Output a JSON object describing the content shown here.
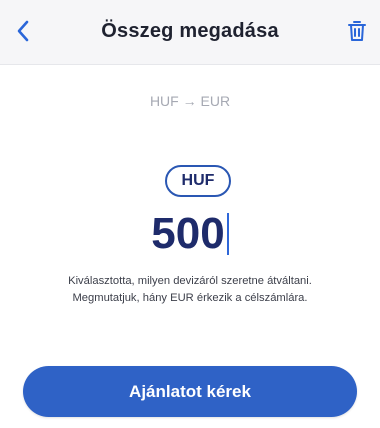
{
  "header": {
    "title": "Összeg megadása",
    "back_icon": "chevron-left-icon",
    "trash_icon": "trash-icon"
  },
  "conversion": {
    "pair_label": "HUF → EUR"
  },
  "amount": {
    "currency": "HUF",
    "value": "500"
  },
  "helper": {
    "line1": "Kiválasztotta, milyen devizáról szeretne átváltani.",
    "line2": "Megmutatjuk, hány EUR érkezik a célszámlára."
  },
  "cta": {
    "label": "Ajánlatot kérek"
  },
  "colors": {
    "accent": "#2f62c6",
    "navy_text": "#1e2b6b",
    "muted_text": "#a6a9b3",
    "header_bg": "#f6f6f8"
  }
}
